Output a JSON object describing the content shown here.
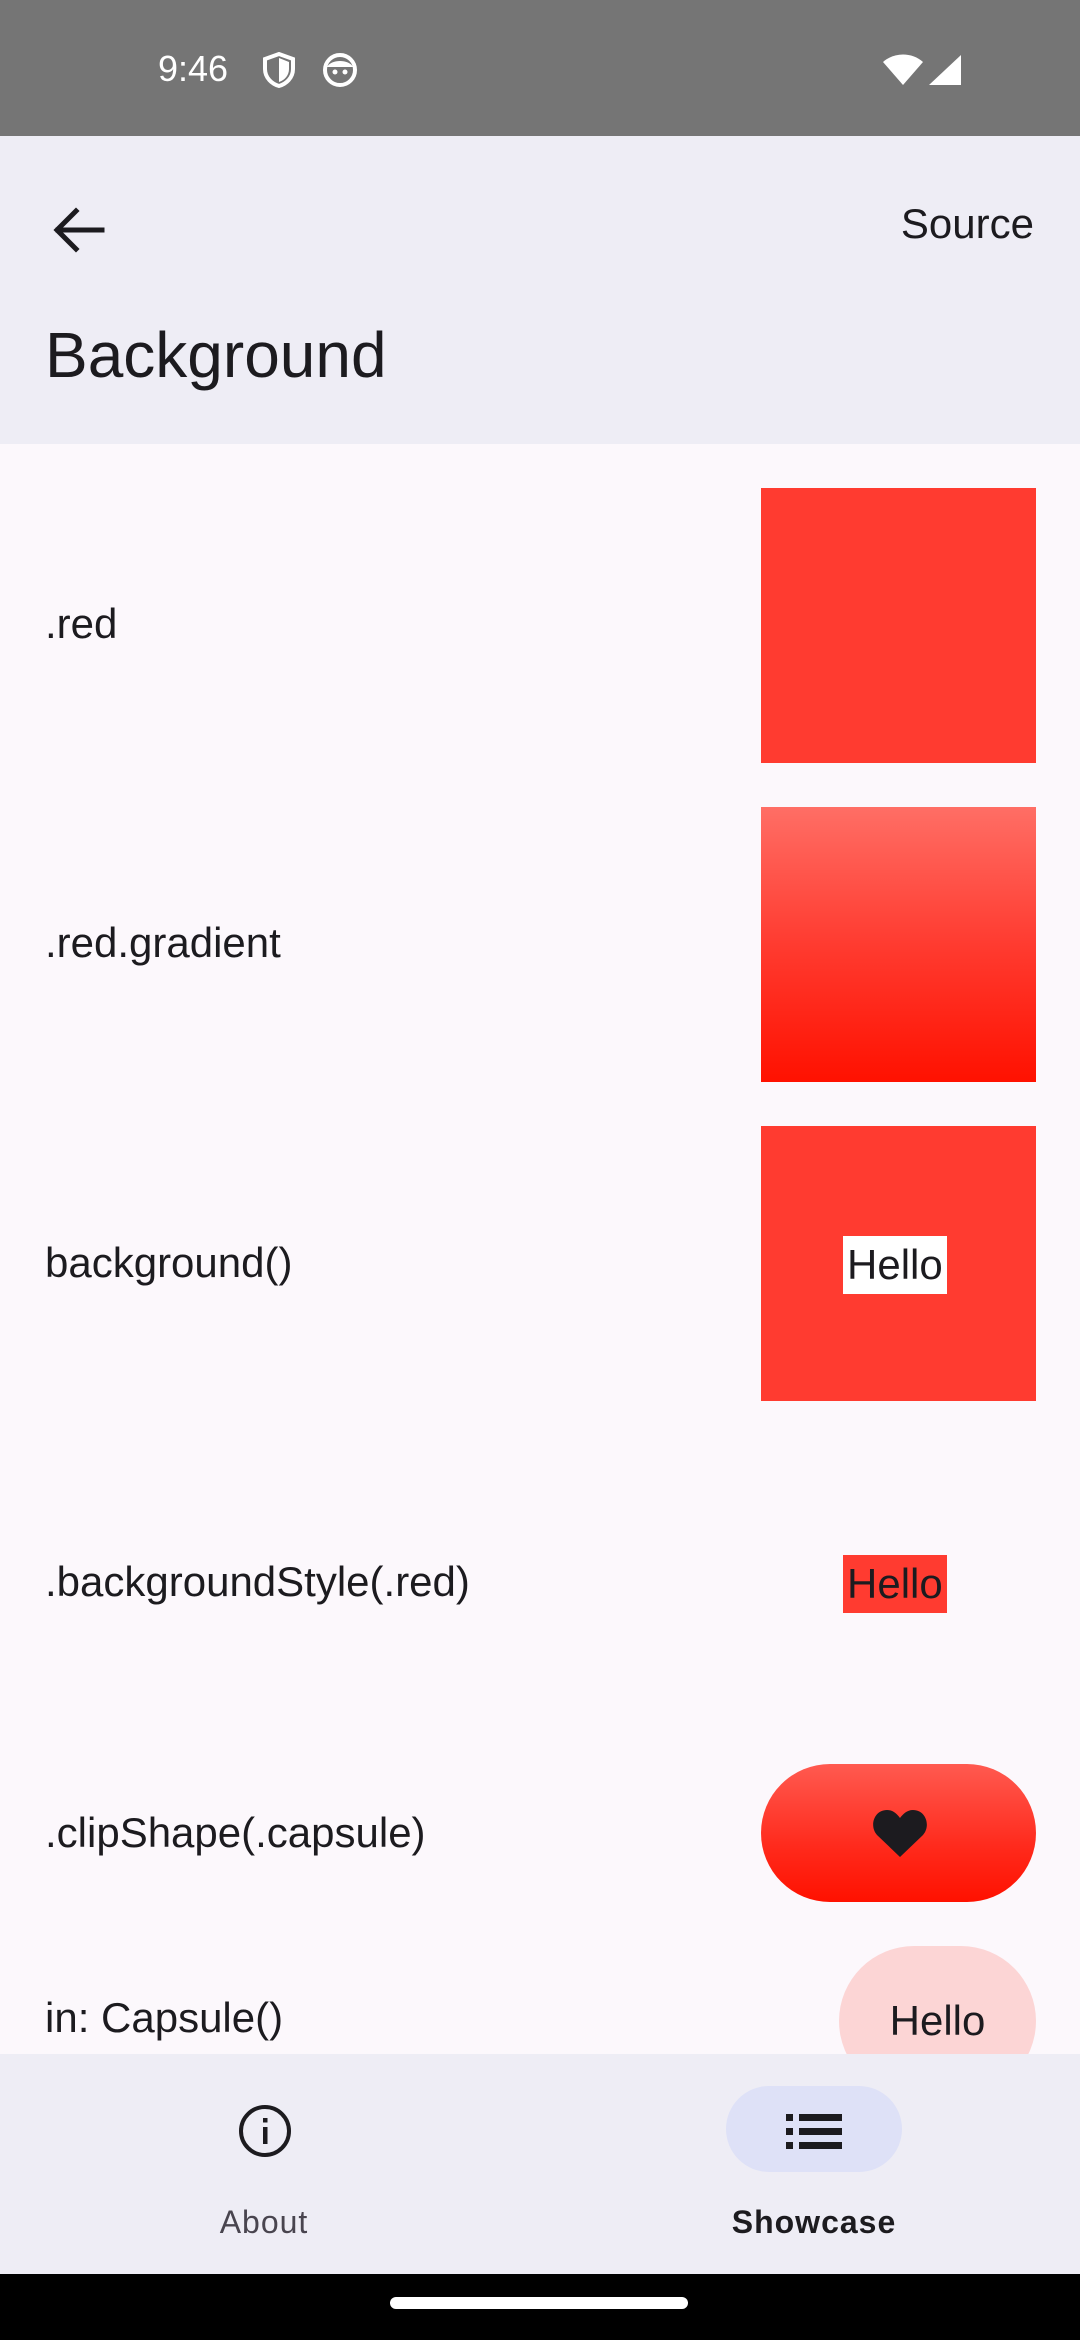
{
  "status_bar": {
    "time": "9:46"
  },
  "app_bar": {
    "title": "Background",
    "action_label": "Source"
  },
  "rows": [
    {
      "label": ".red"
    },
    {
      "label": ".red.gradient"
    },
    {
      "label": "background()",
      "sample_text": "Hello"
    },
    {
      "label": ".backgroundStyle(.red)",
      "sample_text": "Hello"
    },
    {
      "label": ".clipShape(.capsule)"
    },
    {
      "label": "in: Capsule()",
      "sample_text": "Hello"
    }
  ],
  "bottom_nav": {
    "items": [
      {
        "label": "About",
        "icon": "info-icon",
        "selected": false
      },
      {
        "label": "Showcase",
        "icon": "list-icon",
        "selected": true
      }
    ]
  },
  "colors": {
    "red": "#ff3b30",
    "app_bar_bg": "#eeedf5",
    "nav_indicator": "#dee1f7",
    "capsule_tint": "#fcd5d5"
  }
}
